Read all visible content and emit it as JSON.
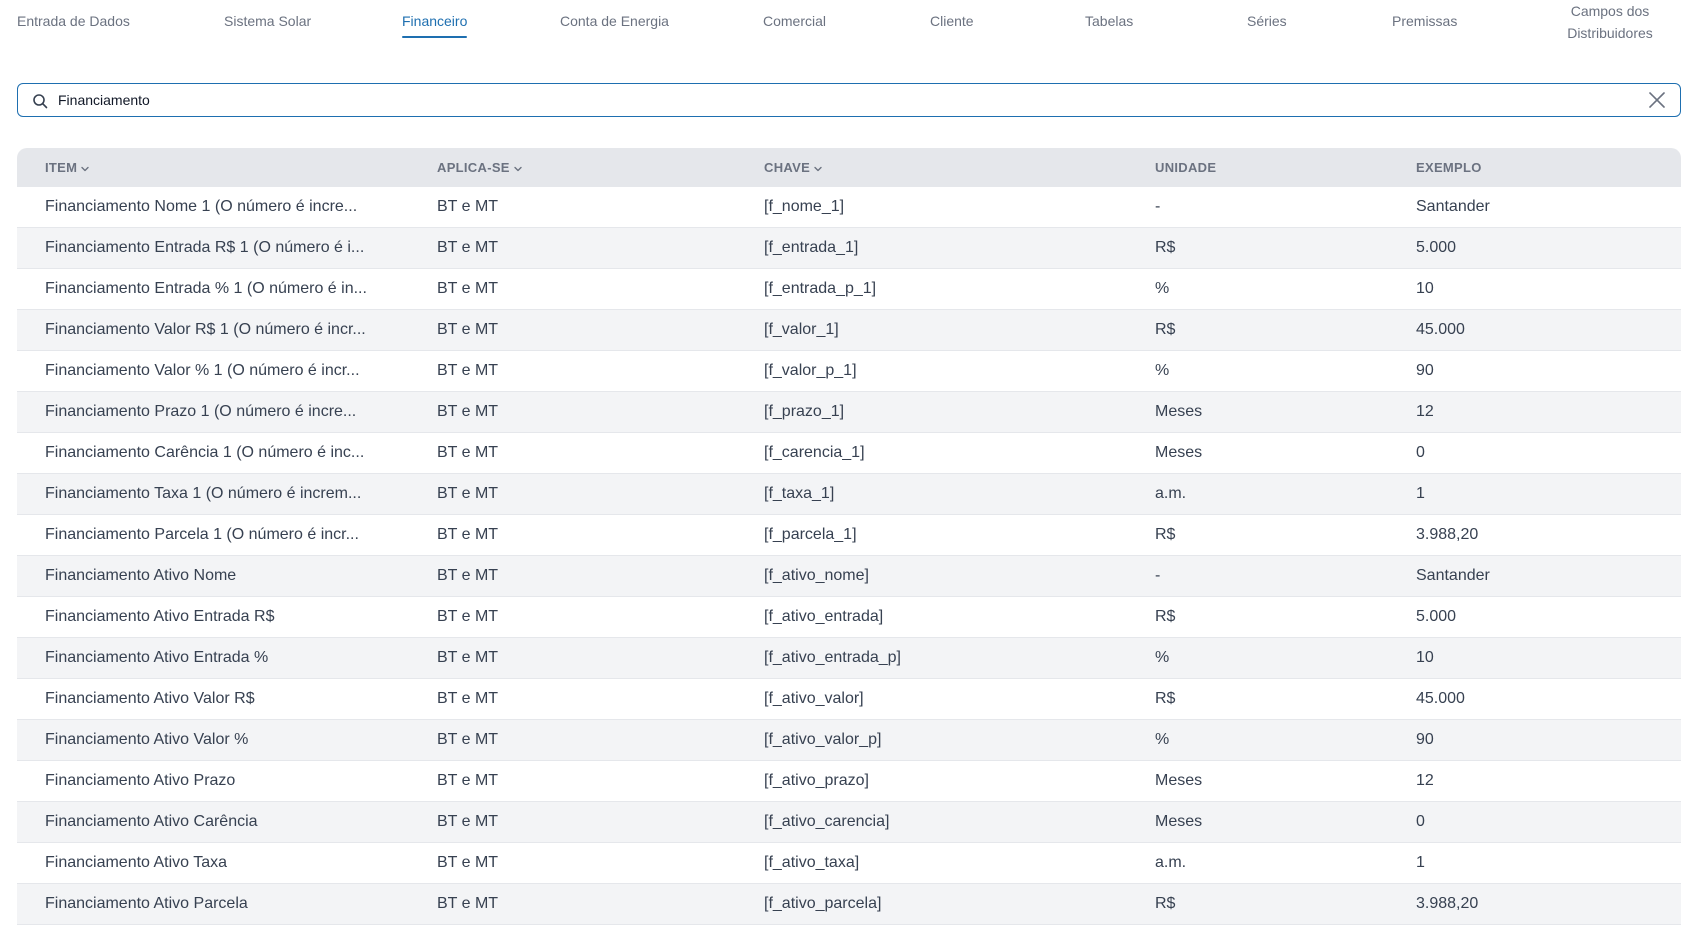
{
  "tabs": [
    {
      "label": "Entrada de Dados",
      "active": false
    },
    {
      "label": "Sistema Solar",
      "active": false
    },
    {
      "label": "Financeiro",
      "active": true
    },
    {
      "label": "Conta de Energia",
      "active": false
    },
    {
      "label": "Comercial",
      "active": false
    },
    {
      "label": "Cliente",
      "active": false
    },
    {
      "label": "Tabelas",
      "active": false
    },
    {
      "label": "Séries",
      "active": false
    },
    {
      "label": "Premissas",
      "active": false
    },
    {
      "label": "Campos dos Distribuidores",
      "active": false
    }
  ],
  "search": {
    "value": "Financiamento",
    "icon": "search-icon",
    "clear_icon": "close-icon"
  },
  "table": {
    "columns": [
      {
        "label": "ITEM",
        "sortable": true
      },
      {
        "label": "APLICA-SE",
        "sortable": true
      },
      {
        "label": "CHAVE",
        "sortable": true
      },
      {
        "label": "UNIDADE",
        "sortable": false
      },
      {
        "label": "EXEMPLO",
        "sortable": false
      }
    ],
    "rows": [
      [
        "Financiamento Nome 1 (O número é incre...",
        "BT e MT",
        "[f_nome_1]",
        "-",
        "Santander"
      ],
      [
        "Financiamento Entrada R$ 1 (O número é i...",
        "BT e MT",
        "[f_entrada_1]",
        "R$",
        "5.000"
      ],
      [
        "Financiamento Entrada % 1 (O número é in...",
        "BT e MT",
        "[f_entrada_p_1]",
        "%",
        "10"
      ],
      [
        "Financiamento Valor R$ 1 (O número é incr...",
        "BT e MT",
        "[f_valor_1]",
        "R$",
        "45.000"
      ],
      [
        "Financiamento Valor % 1 (O número é incr...",
        "BT e MT",
        "[f_valor_p_1]",
        "%",
        "90"
      ],
      [
        "Financiamento Prazo 1 (O número é incre...",
        "BT e MT",
        "[f_prazo_1]",
        "Meses",
        "12"
      ],
      [
        "Financiamento Carência 1 (O número é inc...",
        "BT e MT",
        "[f_carencia_1]",
        "Meses",
        "0"
      ],
      [
        "Financiamento Taxa 1 (O número é increm...",
        "BT e MT",
        "[f_taxa_1]",
        "a.m.",
        "1"
      ],
      [
        "Financiamento Parcela 1 (O número é incr...",
        "BT e MT",
        "[f_parcela_1]",
        "R$",
        "3.988,20"
      ],
      [
        "Financiamento Ativo Nome",
        "BT e MT",
        "[f_ativo_nome]",
        "-",
        "Santander"
      ],
      [
        "Financiamento Ativo Entrada R$",
        "BT e MT",
        "[f_ativo_entrada]",
        "R$",
        "5.000"
      ],
      [
        "Financiamento Ativo Entrada %",
        "BT e MT",
        "[f_ativo_entrada_p]",
        "%",
        "10"
      ],
      [
        "Financiamento Ativo Valor R$",
        "BT e MT",
        "[f_ativo_valor]",
        "R$",
        "45.000"
      ],
      [
        "Financiamento Ativo Valor %",
        "BT e MT",
        "[f_ativo_valor_p]",
        "%",
        "90"
      ],
      [
        "Financiamento Ativo Prazo",
        "BT e MT",
        "[f_ativo_prazo]",
        "Meses",
        "12"
      ],
      [
        "Financiamento Ativo Carência",
        "BT e MT",
        "[f_ativo_carencia]",
        "Meses",
        "0"
      ],
      [
        "Financiamento Ativo Taxa",
        "BT e MT",
        "[f_ativo_taxa]",
        "a.m.",
        "1"
      ],
      [
        "Financiamento Ativo Parcela",
        "BT e MT",
        "[f_ativo_parcela]",
        "R$",
        "3.988,20"
      ]
    ]
  },
  "colors": {
    "accent": "#1e6fb0",
    "header_bg": "#e5e7eb",
    "row_alt_bg": "#f3f4f6",
    "text": "#374151",
    "muted": "#6b7280"
  }
}
